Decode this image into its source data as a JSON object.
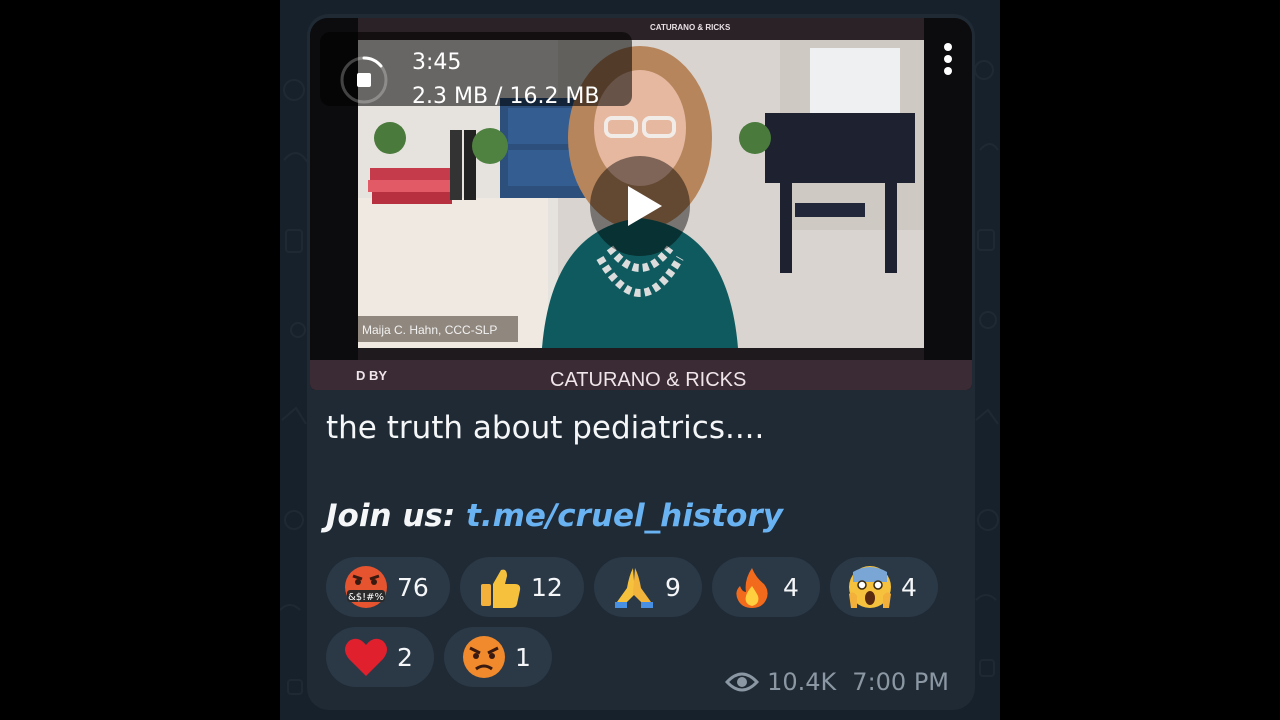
{
  "video": {
    "duration": "3:45",
    "download_size": "2.3 MB / 16.2 MB",
    "download_progress": 0.14,
    "banner_repeat": "CATURANO & RICKS",
    "name_tag": "Maija C. Hahn, CCC-SLP",
    "bottom_prefix": "D BY",
    "bottom_brand": "CATURANO  & RICKS"
  },
  "message": {
    "caption": "the truth about pediatrics....",
    "join_label": "Join us: ",
    "join_link": "t.me/cruel_history",
    "views": "10.4K",
    "time": "7:00 PM"
  },
  "reactions": [
    {
      "icon": "cursing-face-icon",
      "count": "76"
    },
    {
      "icon": "thumbs-up-icon",
      "count": "12"
    },
    {
      "icon": "folded-hands-icon",
      "count": "9"
    },
    {
      "icon": "fire-icon",
      "count": "4"
    },
    {
      "icon": "screaming-face-icon",
      "count": "4"
    },
    {
      "icon": "red-heart-icon",
      "count": "2"
    },
    {
      "icon": "angry-face-icon",
      "count": "1"
    }
  ],
  "colors": {
    "background": "#17212b",
    "bubble": "#1f2a35",
    "reaction_pill": "#2b3947",
    "link": "#6ab3f3",
    "meta_text": "#8b97a3"
  }
}
